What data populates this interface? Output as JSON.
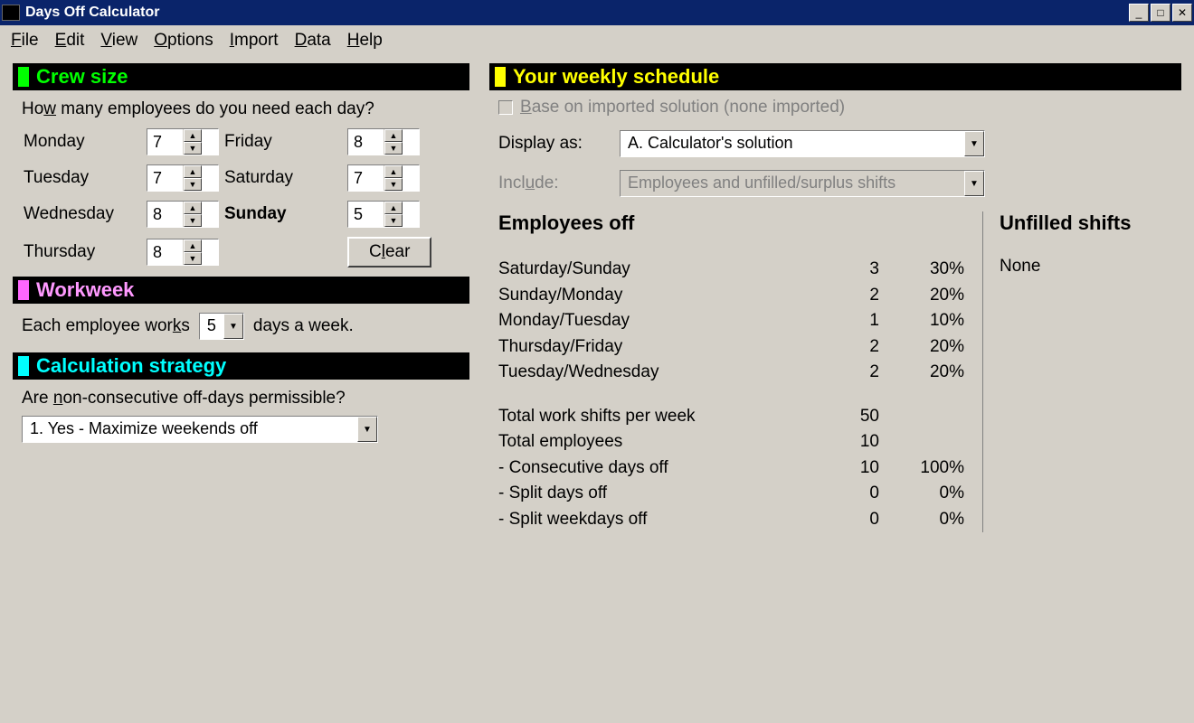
{
  "window": {
    "title": "Days Off Calculator"
  },
  "menu": {
    "file": "File",
    "file_u": "F",
    "edit": "Edit",
    "edit_u": "E",
    "view": "View",
    "view_u": "V",
    "options": "Options",
    "options_u": "O",
    "import": "Import",
    "import_u": "I",
    "data": "Data",
    "data_u": "D",
    "help": "Help",
    "help_u": "H"
  },
  "crew": {
    "title": "Crew size",
    "prompt_pre": "Ho",
    "prompt_u": "w",
    "prompt_post": " many employees do you need each day?",
    "days": {
      "monday": {
        "label": "Monday",
        "value": "7"
      },
      "tuesday": {
        "label": "Tuesday",
        "value": "7"
      },
      "wednesday": {
        "label": "Wednesday",
        "value": "8"
      },
      "thursday": {
        "label": "Thursday",
        "value": "8"
      },
      "friday": {
        "label": "Friday",
        "value": "8"
      },
      "saturday": {
        "label": "Saturday",
        "value": "7"
      },
      "sunday": {
        "label": "Sunday",
        "value": "5"
      }
    },
    "clear_pre": "C",
    "clear_u": "l",
    "clear_post": "ear"
  },
  "workweek": {
    "title": "Workweek",
    "pre": "Each employee wor",
    "u": "k",
    "mid": "s",
    "value": "5",
    "post": "days a week."
  },
  "calc": {
    "title": "Calculation strategy",
    "prompt_pre": "Are ",
    "prompt_u": "n",
    "prompt_post": "on-consecutive off-days permissible?",
    "selected": "1. Yes - Maximize weekends off"
  },
  "sched": {
    "title": "Your weekly schedule",
    "base_pre": "B",
    "base_u": "a",
    "base_post": "se on imported solution (none imported)",
    "display_label": "Display as:",
    "display_value": "A. Calculator's solution",
    "include_pre": "Incl",
    "include_u": "u",
    "include_post": "de:",
    "include_value": "Employees and unfilled/surplus shifts",
    "emp_off_title": "Employees off",
    "unfilled_title": "Unfilled shifts",
    "unfilled_value": "None",
    "off_rows": [
      {
        "label": "Saturday/Sunday",
        "count": "3",
        "pct": "30%"
      },
      {
        "label": "Sunday/Monday",
        "count": "2",
        "pct": "20%"
      },
      {
        "label": "Monday/Tuesday",
        "count": "1",
        "pct": "10%"
      },
      {
        "label": "Thursday/Friday",
        "count": "2",
        "pct": "20%"
      },
      {
        "label": "Tuesday/Wednesday",
        "count": "2",
        "pct": "20%"
      }
    ],
    "totals": [
      {
        "label": "Total work shifts per week",
        "count": "50",
        "pct": ""
      },
      {
        "label": "Total employees",
        "count": "10",
        "pct": ""
      },
      {
        "label": "- Consecutive days off",
        "count": "10",
        "pct": "100%"
      },
      {
        "label": "- Split days off",
        "count": "0",
        "pct": "0%"
      },
      {
        "label": "- Split weekdays off",
        "count": "0",
        "pct": "0%"
      }
    ]
  }
}
